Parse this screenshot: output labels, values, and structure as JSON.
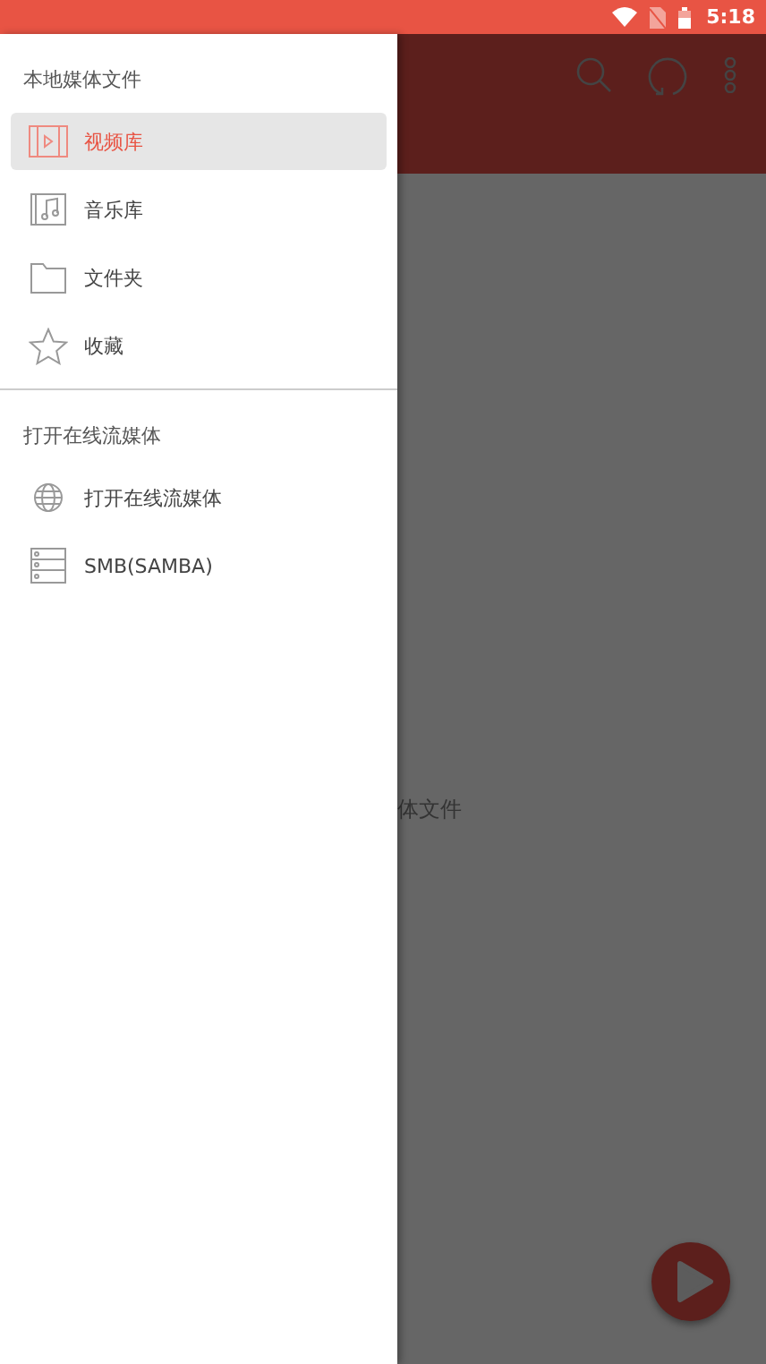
{
  "status_bar": {
    "time": "5:18"
  },
  "drawer": {
    "sections": [
      {
        "header": "本地媒体文件",
        "items": [
          {
            "kind": "video",
            "label": "视频库",
            "selected": true
          },
          {
            "kind": "music",
            "label": "音乐库",
            "selected": false
          },
          {
            "kind": "folder",
            "label": "文件夹",
            "selected": false
          },
          {
            "kind": "star",
            "label": "收藏",
            "selected": false
          }
        ]
      },
      {
        "header": "打开在线流媒体",
        "items": [
          {
            "kind": "globe",
            "label": "打开在线流媒体",
            "selected": false
          },
          {
            "kind": "server",
            "label": "SMB(SAMBA)",
            "selected": false
          }
        ]
      }
    ]
  },
  "background": {
    "empty_text": "体文件"
  }
}
